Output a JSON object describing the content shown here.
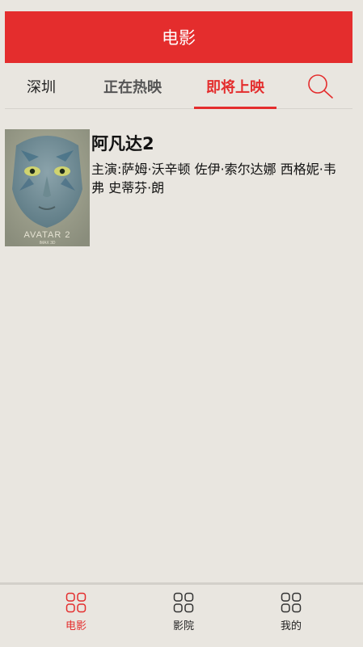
{
  "header": {
    "title": "电影"
  },
  "nav": {
    "city": "深圳",
    "tabs": [
      {
        "label": "正在热映",
        "active": false
      },
      {
        "label": "即将上映",
        "active": true
      }
    ],
    "search_icon": "search-icon"
  },
  "movies": [
    {
      "title": "阿凡达2",
      "cast": "主演:萨姆·沃辛顿 佐伊·索尔达娜 西格妮·韦弗 史蒂芬·朗",
      "poster_text": "AVATAR 2",
      "poster_subtext": "IMAX 3D"
    }
  ],
  "tabbar": {
    "items": [
      {
        "label": "电影",
        "icon": "grid-icon",
        "active": true
      },
      {
        "label": "影院",
        "icon": "grid-icon",
        "active": false
      },
      {
        "label": "我的",
        "icon": "grid-icon",
        "active": false
      }
    ]
  },
  "colors": {
    "accent": "#e42d2d",
    "background": "#e9e6e0"
  }
}
